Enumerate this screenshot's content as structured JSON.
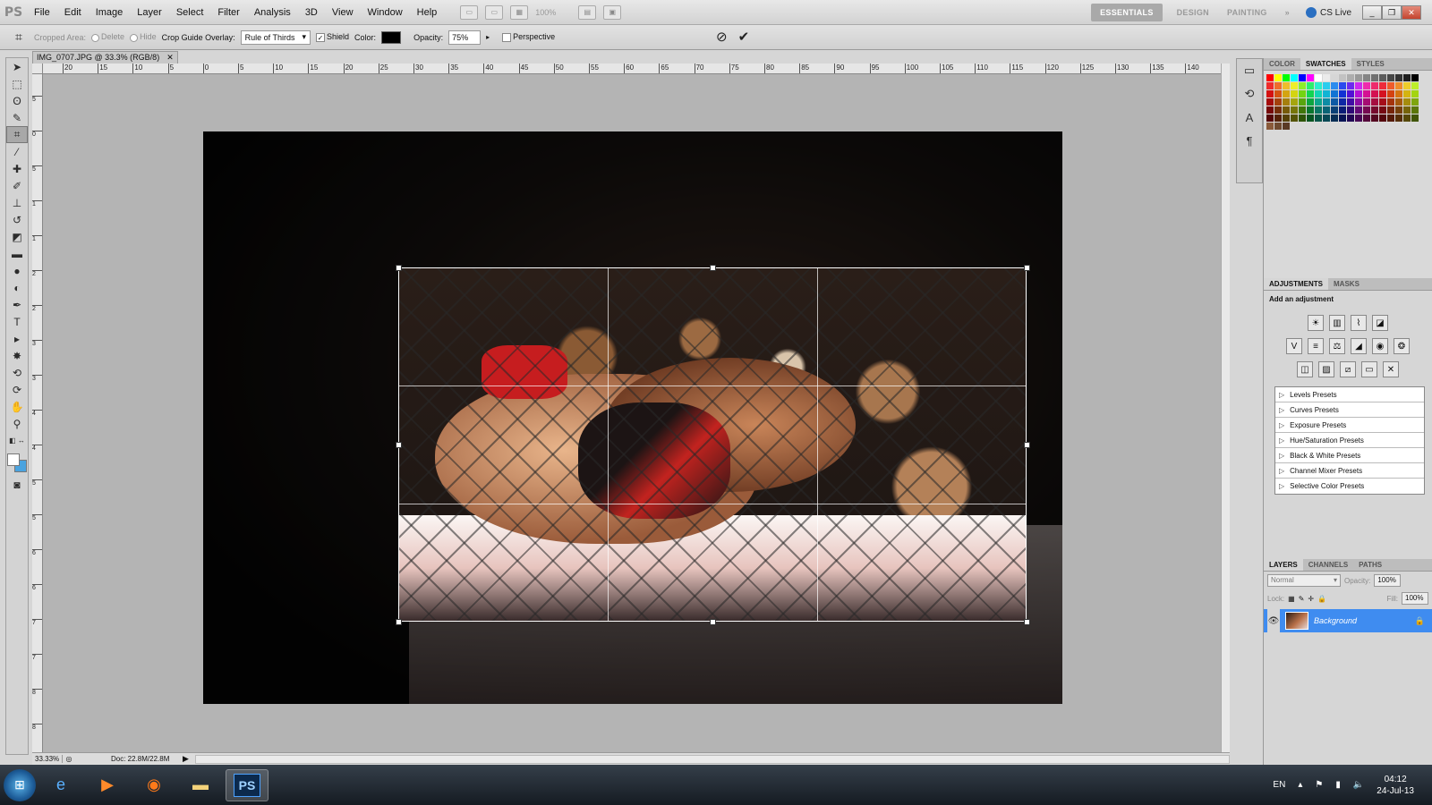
{
  "app": {
    "logo": "PS",
    "menu": [
      "File",
      "Edit",
      "Image",
      "Layer",
      "Select",
      "Filter",
      "Analysis",
      "3D",
      "View",
      "Window",
      "Help"
    ],
    "zoom_level": "100%",
    "workspaces": [
      "ESSENTIALS",
      "DESIGN",
      "PAINTING"
    ],
    "cslive": "CS Live"
  },
  "options": {
    "cropped_area_label": "Cropped Area:",
    "delete_label": "Delete",
    "hide_label": "Hide",
    "overlay_label": "Crop Guide Overlay:",
    "overlay_value": "Rule of Thirds",
    "shield_label": "Shield",
    "color_label": "Color:",
    "opacity_label": "Opacity:",
    "opacity_value": "75%",
    "perspective_label": "Perspective",
    "shield_color": "#000000"
  },
  "document": {
    "tab_title": "IMG_0707.JPG @ 33.3% (RGB/8)",
    "zoom": "33.33%",
    "doc_size": "Doc: 22.8M/22.8M",
    "ruler_h": [
      "20",
      "15",
      "10",
      "5",
      "0",
      "5",
      "10",
      "15",
      "20",
      "25",
      "30",
      "35",
      "40",
      "45",
      "50",
      "55",
      "60",
      "65",
      "70",
      "75",
      "80",
      "85",
      "90",
      "95",
      "100",
      "105",
      "110",
      "115",
      "120",
      "125",
      "130",
      "135",
      "140"
    ],
    "ruler_v": [
      "5",
      "0",
      "5",
      "1",
      "1",
      "2",
      "2",
      "3",
      "3",
      "4",
      "4",
      "5",
      "5",
      "6",
      "6",
      "7",
      "7",
      "8",
      "8"
    ]
  },
  "panels": {
    "color_tabs": [
      "COLOR",
      "SWATCHES",
      "STYLES"
    ],
    "adj_tabs": [
      "ADJUSTMENTS",
      "MASKS"
    ],
    "adj_title": "Add an adjustment",
    "presets": [
      "Levels Presets",
      "Curves Presets",
      "Exposure Presets",
      "Hue/Saturation Presets",
      "Black & White Presets",
      "Channel Mixer Presets",
      "Selective Color Presets"
    ],
    "layer_tabs": [
      "LAYERS",
      "CHANNELS",
      "PATHS"
    ],
    "blend_mode": "Normal",
    "opacity_label": "Opacity:",
    "opacity": "100%",
    "lock_label": "Lock:",
    "fill_label": "Fill:",
    "fill": "100%",
    "layer_name": "Background"
  },
  "taskbar": {
    "lang": "EN",
    "time": "04:12",
    "date": "24-Jul-13"
  }
}
